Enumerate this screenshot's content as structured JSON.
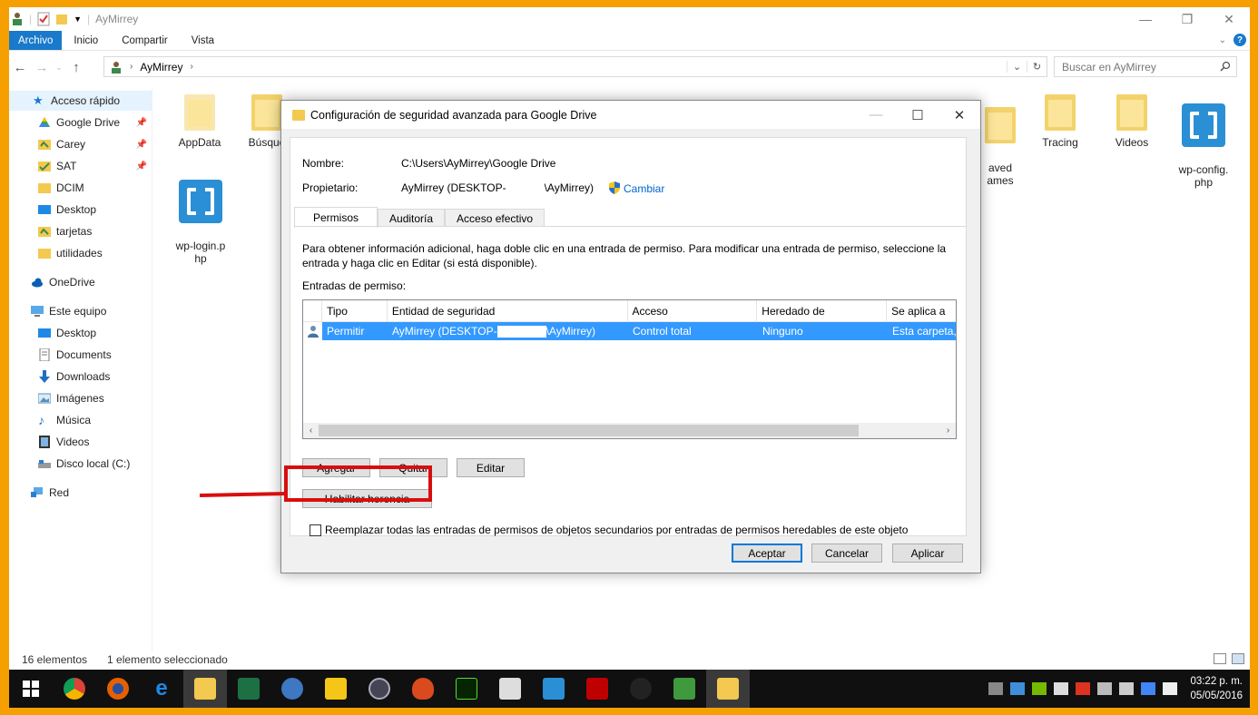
{
  "window": {
    "title": "AyMirrey",
    "controls": [
      "minimize-icon",
      "restore-icon",
      "close-icon"
    ]
  },
  "ribbon": {
    "tabs": [
      "Archivo",
      "Inicio",
      "Compartir",
      "Vista"
    ]
  },
  "addressbar": {
    "path": "AyMirrey",
    "search_placeholder": "Buscar en AyMirrey"
  },
  "sidebar": {
    "items": [
      {
        "label": "Acceso rápido",
        "icon": "star-icon"
      },
      {
        "label": "Google Drive",
        "icon": "google-drive-icon",
        "pinned": true
      },
      {
        "label": "Carey",
        "icon": "folder-icon",
        "pinned": true
      },
      {
        "label": "SAT",
        "icon": "folder-icon",
        "pinned": true
      },
      {
        "label": "DCIM",
        "icon": "folder-icon"
      },
      {
        "label": "Desktop",
        "icon": "desktop-icon"
      },
      {
        "label": "tarjetas",
        "icon": "folder-icon"
      },
      {
        "label": "utilidades",
        "icon": "folder-icon"
      },
      {
        "label": "OneDrive",
        "icon": "cloud-icon"
      },
      {
        "label": "Este equipo",
        "icon": "computer-icon"
      },
      {
        "label": "Desktop",
        "icon": "desktop-icon"
      },
      {
        "label": "Documents",
        "icon": "documents-icon"
      },
      {
        "label": "Downloads",
        "icon": "download-icon"
      },
      {
        "label": "Imágenes",
        "icon": "pictures-icon"
      },
      {
        "label": "Música",
        "icon": "music-icon"
      },
      {
        "label": "Videos",
        "icon": "videos-icon"
      },
      {
        "label": "Disco local (C:)",
        "icon": "drive-icon"
      },
      {
        "label": "Red",
        "icon": "network-icon"
      }
    ]
  },
  "files": {
    "items": [
      {
        "label": "AppData",
        "icon": "folder-icon"
      },
      {
        "label": "Búsque",
        "icon": "folder-search-icon"
      },
      {
        "label": "aved\names",
        "icon": "folder-icon"
      },
      {
        "label": "Tracing",
        "icon": "folder-icon"
      },
      {
        "label": "Videos",
        "icon": "videos-folder-icon"
      },
      {
        "label": "wp-config.\nphp",
        "icon": "brackets-file-icon"
      },
      {
        "label": "wp-login.p\nhp",
        "icon": "brackets-file-icon"
      }
    ]
  },
  "status": {
    "count": "16 elementos",
    "selected": "1 elemento seleccionado"
  },
  "dialog": {
    "title": "Configuración de seguridad avanzada para Google Drive",
    "name_label": "Nombre:",
    "name_value": "C:\\Users\\AyMirrey\\Google Drive",
    "owner_label": "Propietario:",
    "owner_value_a": "AyMirrey (DESKTOP-",
    "owner_value_b": "\\AyMirrey)",
    "change_link": "Cambiar",
    "tabs": [
      "Permisos",
      "Auditoría",
      "Acceso efectivo"
    ],
    "info": "Para obtener información adicional, haga doble clic en una entrada de permiso. Para modificar una entrada de permiso, seleccione la entrada y haga clic en Editar (si está disponible).",
    "entries_label": "Entradas de permiso:",
    "columns": [
      "Tipo",
      "Entidad de seguridad",
      "Acceso",
      "Heredado de",
      "Se aplica a"
    ],
    "rows": [
      {
        "type": "Permitir",
        "entity_a": "AyMirrey (DESKTOP-",
        "entity_b": "\\AyMirrey)",
        "access": "Control total",
        "inherited": "Ninguno",
        "applies": "Esta carpeta,"
      }
    ],
    "buttons": {
      "add": "Agregar",
      "remove": "Quitar",
      "edit": "Editar",
      "enable_inheritance": "Habilitar herencia",
      "ok": "Aceptar",
      "cancel": "Cancelar",
      "apply": "Aplicar"
    },
    "replace_checkbox": "Reemplazar todas las entradas de permisos de objetos secundarios por entradas de permisos heredables de este objeto"
  },
  "taskbar": {
    "apps": [
      "windows-start-icon",
      "chrome-icon",
      "firefox-icon",
      "edge-icon",
      "file-explorer-icon",
      "excel-icon",
      "thunderbird-icon",
      "sticky-notes-icon",
      "media-icon",
      "flame-app-icon",
      "dreamweaver-icon",
      "calculator-icon",
      "brackets-icon",
      "filezilla-icon",
      "inkscape-icon",
      "camtasia-icon",
      "google-drive-icon"
    ],
    "time": "03:22 p. m.",
    "date": "05/05/2016"
  },
  "colors": {
    "frame": "#f5a000",
    "accent": "#1979ca",
    "selection": "#3399ff",
    "annotation": "#d80e0e"
  }
}
